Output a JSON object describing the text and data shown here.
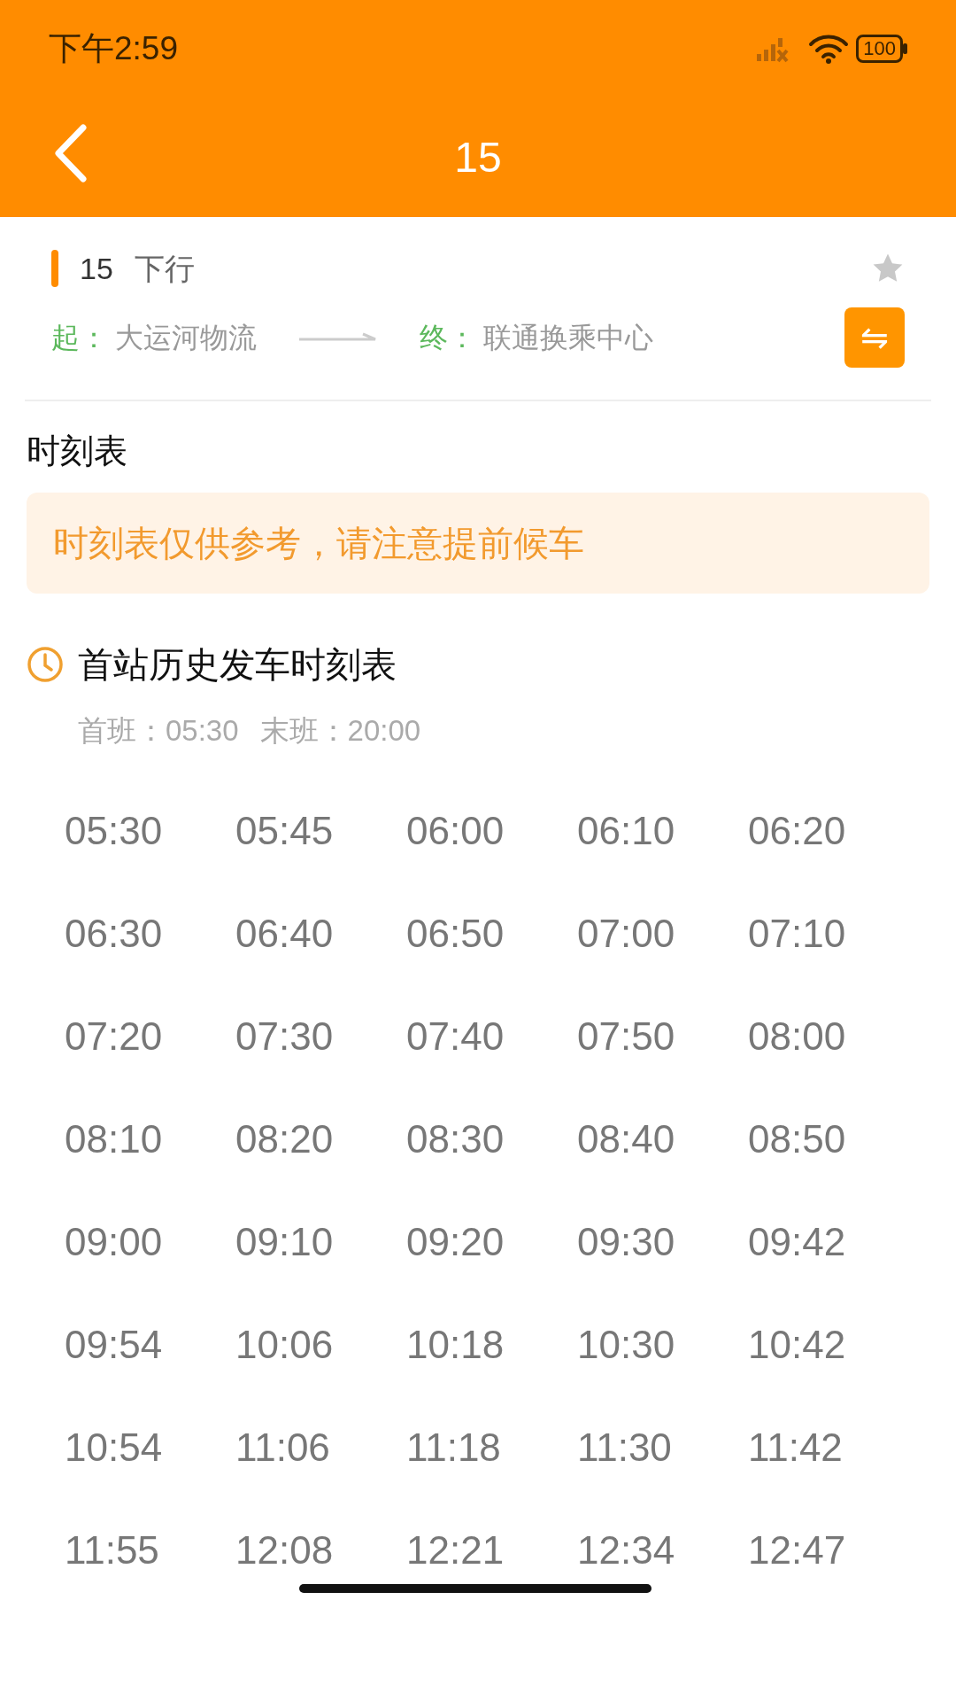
{
  "status_bar": {
    "time": "下午2:59",
    "battery": "100"
  },
  "header": {
    "title": "15"
  },
  "route": {
    "number": "15",
    "direction": "下行",
    "favorite": false,
    "start_label": "起：",
    "start": "大运河物流",
    "end_label": "终：",
    "end": "联通换乘中心",
    "swap_icon": "⇋"
  },
  "section_title": "时刻表",
  "notice": "时刻表仅供参考，请注意提前候车",
  "schedule": {
    "title": "首站历史发车时刻表",
    "first_label": "首班：",
    "first": "05:30",
    "last_label": "末班：",
    "last": "20:00",
    "times": [
      "05:30",
      "05:45",
      "06:00",
      "06:10",
      "06:20",
      "06:30",
      "06:40",
      "06:50",
      "07:00",
      "07:10",
      "07:20",
      "07:30",
      "07:40",
      "07:50",
      "08:00",
      "08:10",
      "08:20",
      "08:30",
      "08:40",
      "08:50",
      "09:00",
      "09:10",
      "09:20",
      "09:30",
      "09:42",
      "09:54",
      "10:06",
      "10:18",
      "10:30",
      "10:42",
      "10:54",
      "11:06",
      "11:18",
      "11:30",
      "11:42",
      "11:55",
      "12:08",
      "12:21",
      "12:34",
      "12:47"
    ]
  }
}
